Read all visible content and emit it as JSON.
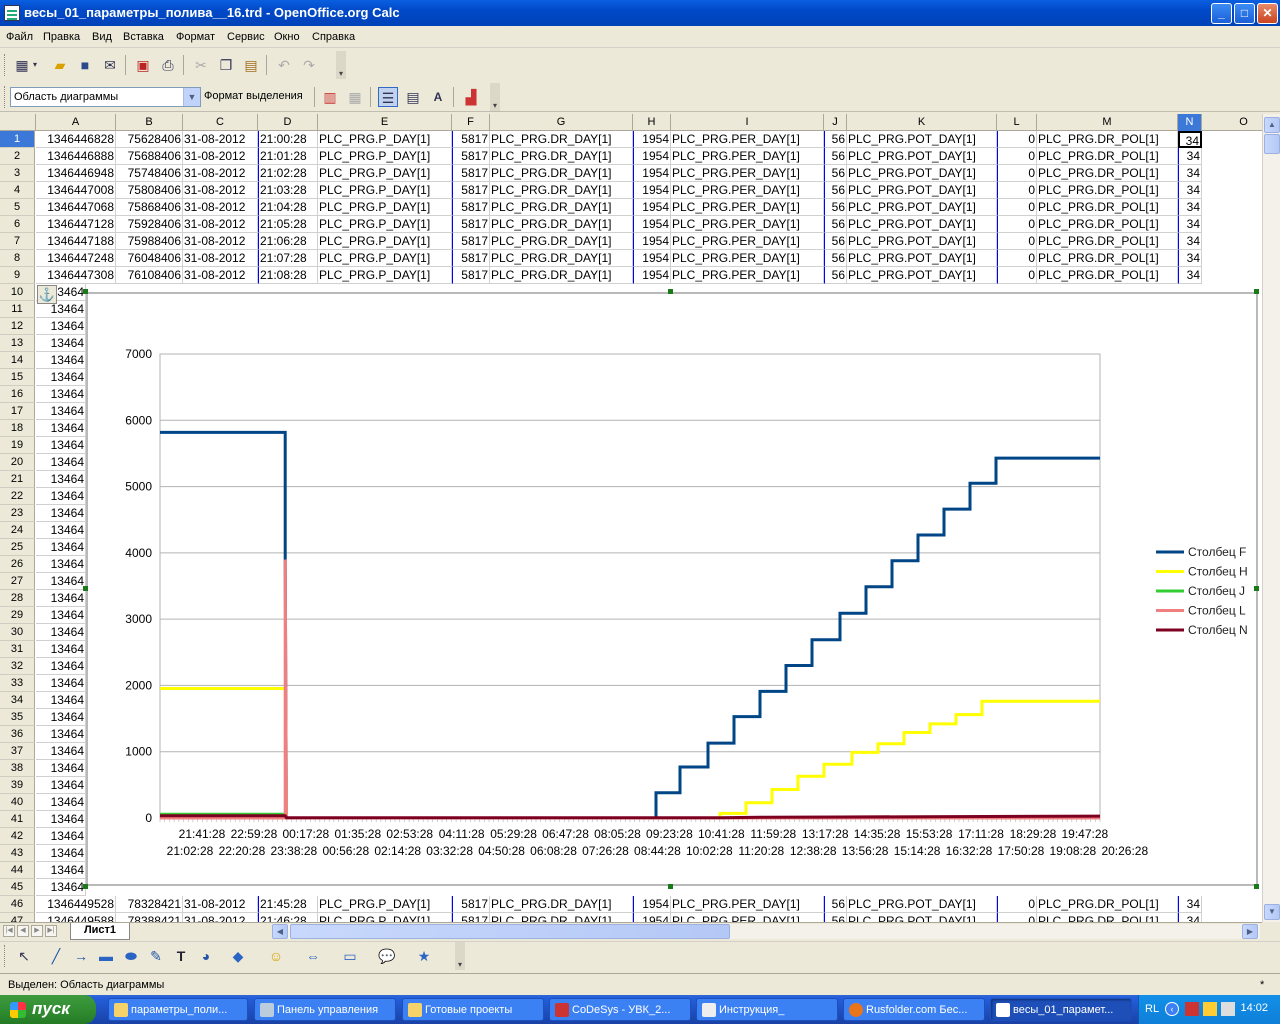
{
  "window": {
    "title": "весы_01_параметры_полива__16.trd - OpenOffice.org Calc",
    "minimize": "_",
    "maximize": "□",
    "close": "✕"
  },
  "menu": [
    "Файл",
    "Правка",
    "Вид",
    "Вставка",
    "Формат",
    "Сервис",
    "Окно",
    "Справка"
  ],
  "format_bar": {
    "selection_combo": "Область диаграммы",
    "format_selection": "Формат выделения"
  },
  "columns": [
    "A",
    "B",
    "C",
    "D",
    "E",
    "F",
    "G",
    "H",
    "I",
    "J",
    "K",
    "L",
    "M",
    "N",
    "O"
  ],
  "rows_top": [
    [
      "1346446828",
      "75628406",
      "31-08-2012",
      "21:00:28",
      "PLC_PRG.P_DAY[1]",
      "5817",
      "PLC_PRG.DR_DAY[1]",
      "1954",
      "PLC_PRG.PER_DAY[1]",
      "56",
      "PLC_PRG.POT_DAY[1]",
      "0",
      "PLC_PRG.DR_POL[1]",
      "34"
    ],
    [
      "1346446888",
      "75688406",
      "31-08-2012",
      "21:01:28",
      "PLC_PRG.P_DAY[1]",
      "5817",
      "PLC_PRG.DR_DAY[1]",
      "1954",
      "PLC_PRG.PER_DAY[1]",
      "56",
      "PLC_PRG.POT_DAY[1]",
      "0",
      "PLC_PRG.DR_POL[1]",
      "34"
    ],
    [
      "1346446948",
      "75748406",
      "31-08-2012",
      "21:02:28",
      "PLC_PRG.P_DAY[1]",
      "5817",
      "PLC_PRG.DR_DAY[1]",
      "1954",
      "PLC_PRG.PER_DAY[1]",
      "56",
      "PLC_PRG.POT_DAY[1]",
      "0",
      "PLC_PRG.DR_POL[1]",
      "34"
    ],
    [
      "1346447008",
      "75808406",
      "31-08-2012",
      "21:03:28",
      "PLC_PRG.P_DAY[1]",
      "5817",
      "PLC_PRG.DR_DAY[1]",
      "1954",
      "PLC_PRG.PER_DAY[1]",
      "56",
      "PLC_PRG.POT_DAY[1]",
      "0",
      "PLC_PRG.DR_POL[1]",
      "34"
    ],
    [
      "1346447068",
      "75868406",
      "31-08-2012",
      "21:04:28",
      "PLC_PRG.P_DAY[1]",
      "5817",
      "PLC_PRG.DR_DAY[1]",
      "1954",
      "PLC_PRG.PER_DAY[1]",
      "56",
      "PLC_PRG.POT_DAY[1]",
      "0",
      "PLC_PRG.DR_POL[1]",
      "34"
    ],
    [
      "1346447128",
      "75928406",
      "31-08-2012",
      "21:05:28",
      "PLC_PRG.P_DAY[1]",
      "5817",
      "PLC_PRG.DR_DAY[1]",
      "1954",
      "PLC_PRG.PER_DAY[1]",
      "56",
      "PLC_PRG.POT_DAY[1]",
      "0",
      "PLC_PRG.DR_POL[1]",
      "34"
    ],
    [
      "1346447188",
      "75988406",
      "31-08-2012",
      "21:06:28",
      "PLC_PRG.P_DAY[1]",
      "5817",
      "PLC_PRG.DR_DAY[1]",
      "1954",
      "PLC_PRG.PER_DAY[1]",
      "56",
      "PLC_PRG.POT_DAY[1]",
      "0",
      "PLC_PRG.DR_POL[1]",
      "34"
    ],
    [
      "1346447248",
      "76048406",
      "31-08-2012",
      "21:07:28",
      "PLC_PRG.P_DAY[1]",
      "5817",
      "PLC_PRG.DR_DAY[1]",
      "1954",
      "PLC_PRG.PER_DAY[1]",
      "56",
      "PLC_PRG.POT_DAY[1]",
      "0",
      "PLC_PRG.DR_POL[1]",
      "34"
    ],
    [
      "1346447308",
      "76108406",
      "31-08-2012",
      "21:08:28",
      "PLC_PRG.P_DAY[1]",
      "5817",
      "PLC_PRG.DR_DAY[1]",
      "1954",
      "PLC_PRG.PER_DAY[1]",
      "56",
      "PLC_PRG.POT_DAY[1]",
      "0",
      "PLC_PRG.DR_POL[1]",
      "34"
    ]
  ],
  "row_numbers": [
    "1",
    "2",
    "3",
    "4",
    "5",
    "6",
    "7",
    "8",
    "9",
    "10",
    "11",
    "12",
    "13",
    "14",
    "15",
    "16",
    "17",
    "18",
    "19",
    "20",
    "21",
    "22",
    "23",
    "24",
    "25",
    "26",
    "27",
    "28",
    "29",
    "30",
    "31",
    "32",
    "33",
    "34",
    "35",
    "36",
    "37",
    "38",
    "39",
    "40",
    "41",
    "42",
    "43",
    "44",
    "45",
    "46",
    "47"
  ],
  "partial_col_a": "13464",
  "rows_bottom": [
    [
      "1346449528",
      "78328421",
      "31-08-2012",
      "21:45:28",
      "PLC_PRG.P_DAY[1]",
      "5817",
      "PLC_PRG.DR_DAY[1]",
      "1954",
      "PLC_PRG.PER_DAY[1]",
      "56",
      "PLC_PRG.POT_DAY[1]",
      "0",
      "PLC_PRG.DR_POL[1]",
      "34"
    ],
    [
      "1346449588",
      "78388421",
      "31-08-2012",
      "21:46:28",
      "PLC_PRG.P_DAY[1]",
      "5817",
      "PLC_PRG.DR_DAY[1]",
      "1954",
      "PLC_PRG.PER_DAY[1]",
      "56",
      "PLC_PRG.POT_DAY[1]",
      "0",
      "PLC_PRG.DR_POL[1]",
      "34"
    ]
  ],
  "chart_data": {
    "type": "line",
    "title": "",
    "xlabel": "",
    "ylabel": "",
    "ylim": [
      0,
      7000
    ],
    "yticks": [
      0,
      1000,
      2000,
      3000,
      4000,
      5000,
      6000,
      7000
    ],
    "grid": true,
    "legend_position": "right",
    "x_tick_labels_row1": [
      "21:41:28",
      "22:59:28",
      "00:17:28",
      "01:35:28",
      "02:53:28",
      "04:11:28",
      "05:29:28",
      "06:47:28",
      "08:05:28",
      "09:23:28",
      "10:41:28",
      "11:59:28",
      "13:17:28",
      "14:35:28",
      "15:53:28",
      "17:11:28",
      "18:29:28",
      "19:47:28"
    ],
    "x_tick_labels_row2": [
      "21:02:28",
      "22:20:28",
      "23:38:28",
      "00:56:28",
      "02:14:28",
      "03:32:28",
      "04:50:28",
      "06:08:28",
      "07:26:28",
      "08:44:28",
      "10:02:28",
      "11:20:28",
      "12:38:28",
      "13:56:28",
      "15:14:28",
      "16:32:28",
      "17:50:28",
      "19:08:28",
      "20:26:28"
    ],
    "x_range_hours": [
      0,
      23.5
    ],
    "series": [
      {
        "name": "Столбец F",
        "color": "#004586",
        "points": [
          [
            0,
            5817
          ],
          [
            3.13,
            5817
          ],
          [
            3.13,
            3900
          ],
          [
            3.16,
            0
          ],
          [
            12.4,
            0
          ],
          [
            12.4,
            380
          ],
          [
            13.0,
            380
          ],
          [
            13.0,
            770
          ],
          [
            13.7,
            770
          ],
          [
            13.7,
            1130
          ],
          [
            14.35,
            1130
          ],
          [
            14.35,
            1530
          ],
          [
            15.0,
            1530
          ],
          [
            15.0,
            1910
          ],
          [
            15.65,
            1910
          ],
          [
            15.65,
            2300
          ],
          [
            16.3,
            2300
          ],
          [
            16.3,
            2690
          ],
          [
            17.0,
            2690
          ],
          [
            17.0,
            3090
          ],
          [
            17.65,
            3090
          ],
          [
            17.65,
            3490
          ],
          [
            18.3,
            3490
          ],
          [
            18.3,
            3880
          ],
          [
            18.95,
            3880
          ],
          [
            18.95,
            4270
          ],
          [
            19.6,
            4270
          ],
          [
            19.6,
            4660
          ],
          [
            20.25,
            4660
          ],
          [
            20.25,
            5050
          ],
          [
            20.9,
            5050
          ],
          [
            20.9,
            5430
          ],
          [
            23.5,
            5430
          ]
        ]
      },
      {
        "name": "Столбец H",
        "color": "#ffff00",
        "points": [
          [
            0,
            1954
          ],
          [
            3.13,
            1954
          ],
          [
            3.16,
            0
          ],
          [
            14.0,
            0
          ],
          [
            14.0,
            70
          ],
          [
            14.65,
            70
          ],
          [
            14.65,
            230
          ],
          [
            15.3,
            230
          ],
          [
            15.3,
            430
          ],
          [
            15.95,
            430
          ],
          [
            15.95,
            630
          ],
          [
            16.6,
            630
          ],
          [
            16.6,
            810
          ],
          [
            17.3,
            810
          ],
          [
            17.3,
            990
          ],
          [
            17.95,
            990
          ],
          [
            17.95,
            1120
          ],
          [
            18.6,
            1120
          ],
          [
            18.6,
            1290
          ],
          [
            19.25,
            1290
          ],
          [
            19.25,
            1420
          ],
          [
            19.9,
            1420
          ],
          [
            19.9,
            1560
          ],
          [
            20.55,
            1560
          ],
          [
            20.55,
            1760
          ],
          [
            23.5,
            1760
          ]
        ]
      },
      {
        "name": "Столбец J",
        "color": "#33cc33",
        "points": [
          [
            0,
            56
          ],
          [
            3.13,
            56
          ],
          [
            3.16,
            0
          ],
          [
            23.5,
            0
          ]
        ]
      },
      {
        "name": "Столбец L",
        "color": "#f08080",
        "points": [
          [
            0,
            0
          ],
          [
            3.13,
            0
          ],
          [
            3.13,
            3900
          ],
          [
            3.16,
            0
          ],
          [
            23.5,
            0
          ]
        ]
      },
      {
        "name": "Столбец N",
        "color": "#7e0021",
        "points": [
          [
            0,
            34
          ],
          [
            3.13,
            34
          ],
          [
            3.16,
            5
          ],
          [
            14.0,
            5
          ],
          [
            15.0,
            10
          ],
          [
            17.0,
            15
          ],
          [
            19.0,
            20
          ],
          [
            23.5,
            28
          ]
        ]
      }
    ]
  },
  "sheet_tab": "Лист1",
  "status": "Выделен: Область диаграммы",
  "status_right": "*",
  "taskbar": {
    "start": "пуск",
    "tasks": [
      "параметры_поли...",
      "Панель управления",
      "Готовые проекты",
      "CoDeSys - УВК_2...",
      "Инструкция_",
      "Rusfolder.com Бес...",
      "весы_01_парамет..."
    ],
    "lang": "RL",
    "clock": "14:02"
  }
}
